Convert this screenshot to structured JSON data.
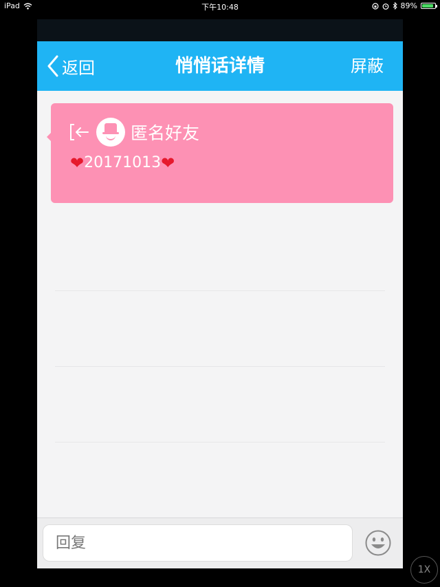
{
  "status_bar": {
    "device": "iPad",
    "time": "下午10:48",
    "battery_percent": "89%",
    "battery_level": 0.89
  },
  "nav": {
    "back_label": "返回",
    "title": "悄悄话详情",
    "block_label": "屏蔽"
  },
  "message": {
    "sender": "匿名好友",
    "text": "20171013",
    "emoji": "❤"
  },
  "reply": {
    "placeholder": "回复"
  },
  "overlay": {
    "speed_label": "1X"
  },
  "colors": {
    "nav_bg": "#1fb4f4",
    "card_bg": "#fd91b4",
    "page_bg": "#f4f4f5",
    "battery_fill": "#4cd964"
  },
  "icons": [
    "wifi-icon",
    "orientation-lock-icon",
    "alarm-icon",
    "bluetooth-icon",
    "battery-icon",
    "back-chevron-icon",
    "exit-arrow-icon",
    "anonymous-avatar-icon",
    "heart-icon",
    "emoji-icon"
  ]
}
